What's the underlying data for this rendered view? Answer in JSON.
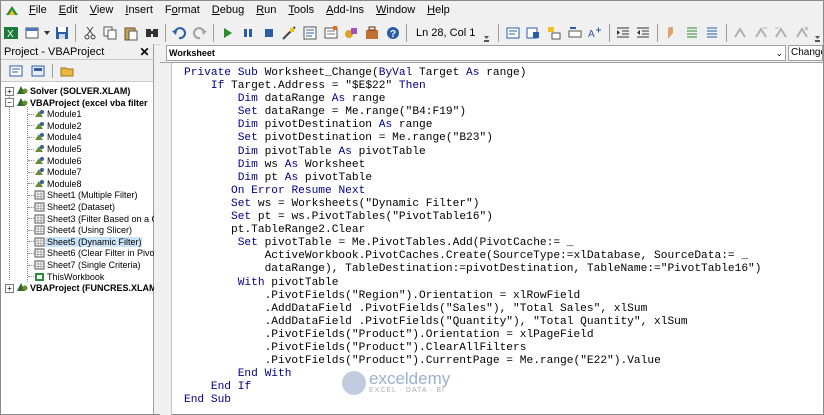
{
  "menu": [
    "File",
    "Edit",
    "View",
    "Insert",
    "Format",
    "Debug",
    "Run",
    "Tools",
    "Add-Ins",
    "Window",
    "Help"
  ],
  "menu_underline": [
    "F",
    "E",
    "V",
    "I",
    "o",
    "D",
    "R",
    "T",
    "A",
    "W",
    "H"
  ],
  "toolbar": {
    "position": "Ln 28, Col 1"
  },
  "project": {
    "title": "Project - VBAProject",
    "close_glyph": "✕",
    "tree": [
      {
        "label": "Solver (SOLVER.XLAM)",
        "bold": true,
        "pm": "+",
        "level": 0
      },
      {
        "label": "VBAProject (excel vba filter",
        "bold": true,
        "pm": "−",
        "level": 0
      },
      {
        "label": "Module1",
        "level": 1,
        "icon": "module-icon"
      },
      {
        "label": "Module2",
        "level": 1,
        "icon": "module-icon"
      },
      {
        "label": "Module4",
        "level": 1,
        "icon": "module-icon"
      },
      {
        "label": "Module5",
        "level": 1,
        "icon": "module-icon"
      },
      {
        "label": "Module6",
        "level": 1,
        "icon": "module-icon"
      },
      {
        "label": "Module7",
        "level": 1,
        "icon": "module-icon"
      },
      {
        "label": "Module8",
        "level": 1,
        "icon": "module-icon"
      },
      {
        "label": "Sheet1 (Multiple Filter)",
        "level": 1,
        "icon": "sheet-icon"
      },
      {
        "label": "Sheet2 (Dataset)",
        "level": 1,
        "icon": "sheet-icon"
      },
      {
        "label": "Sheet3 (Filter Based on a Cel",
        "level": 1,
        "icon": "sheet-icon"
      },
      {
        "label": "Sheet4 (Using Slicer)",
        "level": 1,
        "icon": "sheet-icon"
      },
      {
        "label": "Sheet5 (Dynamic Filter)",
        "level": 1,
        "icon": "sheet-icon",
        "selected": true
      },
      {
        "label": "Sheet6 (Clear Filter in Pivot T",
        "level": 1,
        "icon": "sheet-icon"
      },
      {
        "label": "Sheet7 (Single Criteria)",
        "level": 1,
        "icon": "sheet-icon"
      },
      {
        "label": "ThisWorkbook",
        "level": 1,
        "icon": "workbook-icon"
      },
      {
        "label": "VBAProject (FUNCRES.XLAM)",
        "bold": true,
        "pm": "+",
        "level": 0
      }
    ]
  },
  "code_window": {
    "object": "Worksheet",
    "procedure": "Change",
    "lines": [
      "Private Sub Worksheet_Change(ByVal Target As range)",
      "    If Target.Address = \"$E$22\" Then",
      "        Dim dataRange As range",
      "        Set dataRange = Me.range(\"B4:F19\")",
      "        Dim pivotDestination As range",
      "        Set pivotDestination = Me.range(\"B23\")",
      "        Dim pivotTable As pivotTable",
      "        Dim ws As Worksheet",
      "        Dim pt As pivotTable",
      "       On Error Resume Next",
      "       Set ws = Worksheets(\"Dynamic Filter\")",
      "       Set pt = ws.PivotTables(\"PivotTable16\")",
      "       pt.TableRange2.Clear",
      "        Set pivotTable = Me.PivotTables.Add(PivotCache:= _",
      "            ActiveWorkbook.PivotCaches.Create(SourceType:=xlDatabase, SourceData:= _",
      "            dataRange), TableDestination:=pivotDestination, TableName:=\"PivotTable16\")",
      "        With pivotTable",
      "            .PivotFields(\"Region\").Orientation = xlRowField",
      "            .AddDataField .PivotFields(\"Sales\"), \"Total Sales\", xlSum",
      "            .AddDataField .PivotFields(\"Quantity\"), \"Total Quantity\", xlSum",
      "            .PivotFields(\"Product\").Orientation = xlPageField",
      "            .PivotFields(\"Product\").ClearAllFilters",
      "            .PivotFields(\"Product\").CurrentPage = Me.range(\"E22\").Value",
      "        End With",
      "    End If",
      "End Sub"
    ]
  },
  "keywords": [
    "Private",
    "Sub",
    "ByVal",
    "As",
    "If",
    "Then",
    "Dim",
    "Set",
    "On",
    "Error",
    "Resume",
    "Next",
    "With",
    "End"
  ],
  "colors": {
    "keyword": "#00008b",
    "selected": "#cce4f7"
  },
  "watermark": {
    "name": "exceldemy",
    "sub": "EXCEL · DATA · BI"
  }
}
